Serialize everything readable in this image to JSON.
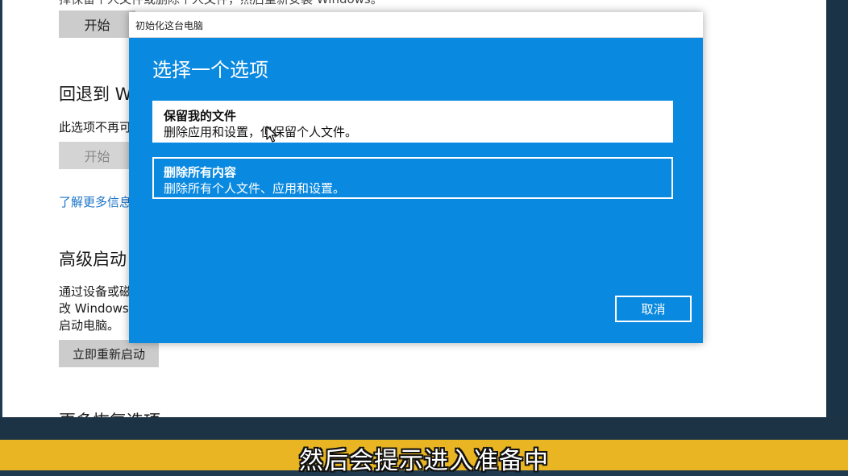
{
  "settings": {
    "top_cut_text": "择保留个人文件或删除个人文件，然后重新安装 Windows。",
    "start_button_1": "开始",
    "go_back_heading": "回退到 W",
    "go_back_desc": "此选项不再可",
    "start_button_2": "开始",
    "learn_more_link": "了解更多信息",
    "advanced_heading": "高级启动",
    "advanced_desc_line1": "通过设备或磁",
    "advanced_desc_line2": "改 Windows",
    "advanced_desc_line3": "启动电脑。",
    "restart_now_button": "立即重新启动",
    "more_recovery_heading": "更多恢复选项"
  },
  "dialog": {
    "title": "初始化这台电脑",
    "heading": "选择一个选项",
    "options": [
      {
        "title": "保留我的文件",
        "desc": "删除应用和设置，但保留个人文件。"
      },
      {
        "title": "删除所有内容",
        "desc": "删除所有个人文件、应用和设置。"
      }
    ],
    "cancel_label": "取消"
  },
  "subtitle": "然后会提示进入准备中",
  "colors": {
    "dialog_blue": "#0a89e0",
    "subtitle_yellow": "#e9b523",
    "link_blue": "#1a73c8"
  },
  "icons": {
    "cursor": "mouse-cursor-icon"
  }
}
